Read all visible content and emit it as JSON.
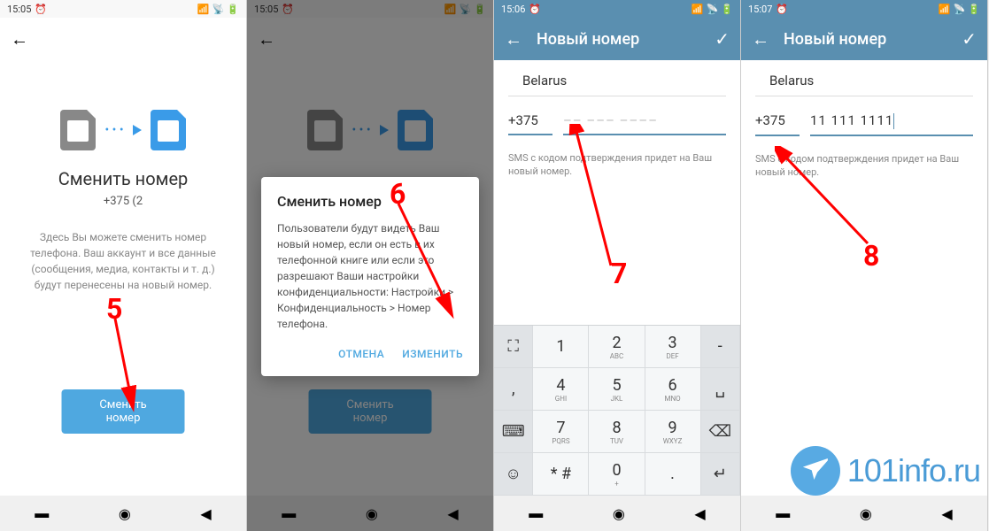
{
  "statusbar": {
    "time1": "15:05",
    "time2": "15:05",
    "time3": "15:06",
    "time4": "15:07"
  },
  "screen1": {
    "title": "Сменить номер",
    "phone": "+375 (2",
    "desc": "Здесь Вы можете сменить номер телефона. Ваш аккаунт и все данные (сообщения, медиа, контакты и т. д.) будут перенесены на новый номер.",
    "button": "Сменить номер"
  },
  "screen2": {
    "dialog_title": "Сменить номер",
    "dialog_text": "Пользователи будут видеть Ваш новый номер, если он есть в их телефонной книге или если это разрешают Ваши настройки конфиденциальности: Настройки > Конфиденциальность > Номер телефона.",
    "cancel": "ОТМЕНА",
    "change": "ИЗМЕНИТЬ"
  },
  "screen3": {
    "title": "Новый номер",
    "country": "Belarus",
    "code": "+375",
    "placeholder": "–– ––– ––––",
    "hint": "SMS с кодом подтверждения придет на Ваш новый номер."
  },
  "screen4": {
    "title": "Новый номер",
    "country": "Belarus",
    "code": "+375",
    "value": "11 111 1111",
    "hint": "SMS с кодом подтверждения придет на Ваш новый номер."
  },
  "keypad": {
    "k1": "1",
    "k2": "2",
    "k3": "3",
    "k4": "4",
    "k5": "5",
    "k6": "6",
    "k7": "7",
    "k8": "8",
    "k9": "9",
    "k0": "0",
    "l2": "ABC",
    "l3": "DEF",
    "l4": "GHI",
    "l5": "JKL",
    "l6": "MNO",
    "l7": "PQRS",
    "l8": "TUV",
    "l9": "WXYZ",
    "star": "*  #",
    "dash": "-",
    "space": "␣",
    "dot": "."
  },
  "anno": {
    "n5": "5",
    "n6": "6",
    "n7": "7",
    "n8": "8"
  },
  "watermark": "101info.ru"
}
